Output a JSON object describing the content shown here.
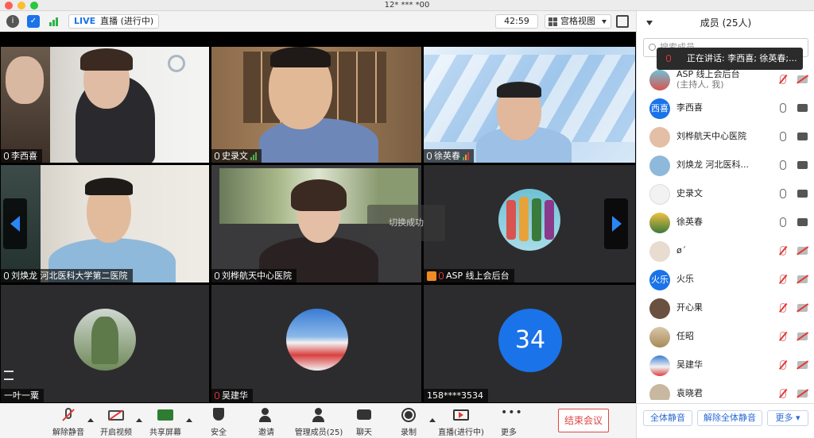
{
  "window": {
    "title": "12* *** *00"
  },
  "topbar": {
    "live_badge": "LIVE",
    "live_status": "直播 (进行中)",
    "timer": "42:59",
    "view_mode": "宫格视图"
  },
  "gallery": {
    "toast": "切换成功",
    "tiles": [
      {
        "name": "李西喜"
      },
      {
        "name": "史录文"
      },
      {
        "name": "徐英春"
      },
      {
        "name": "刘焕龙 河北医科大学第二医院"
      },
      {
        "name": "刘桦航天中心医院"
      },
      {
        "name": "ASP 线上会后台"
      },
      {
        "name": "一叶一粟"
      },
      {
        "name": "吴建华"
      },
      {
        "name": "158****3534",
        "avatar_text": "34"
      }
    ]
  },
  "toolbar": {
    "mute": "解除静音",
    "video": "开启视频",
    "share": "共享屏幕",
    "security": "安全",
    "invite": "邀请",
    "manage": "管理成员(25)",
    "chat": "聊天",
    "record": "录制",
    "live": "直播(进行中)",
    "more": "更多",
    "end": "结束会议"
  },
  "panel": {
    "title": "成员 (25人)",
    "search_placeholder": "搜索成员",
    "speaking": "正在讲话: 李西喜; 徐英春;...",
    "participants": [
      {
        "name": "ASP 线上会后台",
        "sub": "(主持人, 我)",
        "avatar": "",
        "mic_muted": true,
        "cam_off": true
      },
      {
        "name": "李西喜",
        "avatar": "西喜",
        "mic_muted": false,
        "cam_off": false
      },
      {
        "name": "刘桦航天中心医院",
        "avatar": "",
        "mic_muted": false,
        "cam_off": false
      },
      {
        "name": "刘焕龙 河北医科...",
        "avatar": "",
        "mic_muted": false,
        "cam_off": false
      },
      {
        "name": "史录文",
        "avatar": "",
        "mic_muted": false,
        "cam_off": false
      },
      {
        "name": "徐英春",
        "avatar": "",
        "mic_muted": false,
        "cam_off": false
      },
      {
        "name": "ø´",
        "avatar": "",
        "mic_muted": true,
        "cam_off": true
      },
      {
        "name": "火乐",
        "avatar": "火乐",
        "mic_muted": true,
        "cam_off": true
      },
      {
        "name": "开心果",
        "avatar": "",
        "mic_muted": true,
        "cam_off": true
      },
      {
        "name": "任昭",
        "avatar": "",
        "mic_muted": true,
        "cam_off": true
      },
      {
        "name": "吴建华",
        "avatar": "",
        "mic_muted": true,
        "cam_off": true
      },
      {
        "name": "袁晓君",
        "avatar": "",
        "mic_muted": true,
        "cam_off": true
      }
    ],
    "mute_all": "全体静音",
    "unmute_all": "解除全体静音",
    "more": "更多"
  }
}
